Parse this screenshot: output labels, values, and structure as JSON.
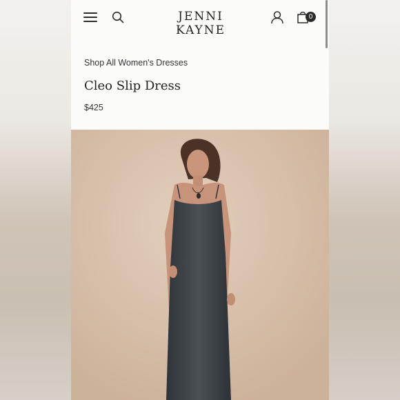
{
  "header": {
    "logo": "JENNI KAYNE",
    "bag_count": "0"
  },
  "icons": {
    "menu": "menu-icon",
    "search": "search-icon",
    "account": "account-icon",
    "bag": "shopping-bag-icon"
  },
  "product": {
    "breadcrumb": "Shop All Women's Dresses",
    "title": "Cleo Slip Dress",
    "price": "$425"
  },
  "image": {
    "subject": "Model wearing charcoal slip dress"
  },
  "colors": {
    "accent": "#2a2a2a",
    "dress": "#3d4347",
    "backdrop": "#d6bea8"
  }
}
